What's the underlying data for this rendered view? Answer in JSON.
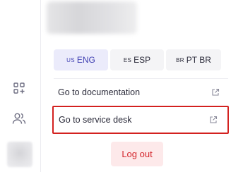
{
  "rail": {
    "icons": [
      "add-widget-icon",
      "users-icon"
    ]
  },
  "languages": [
    {
      "code": "us",
      "label": "ENG",
      "active": true
    },
    {
      "code": "es",
      "label": "ESP",
      "active": false
    },
    {
      "code": "br",
      "label": "PT BR",
      "active": false
    }
  ],
  "links": {
    "documentation": "Go to documentation",
    "service_desk": "Go to service desk"
  },
  "logout_label": "Log out",
  "colors": {
    "accent": "#3f3fb2",
    "active_lang_bg": "#ebebfb",
    "highlight_border": "#d3211f",
    "logout_text": "#d3262d",
    "logout_bg": "#fde9ea"
  }
}
